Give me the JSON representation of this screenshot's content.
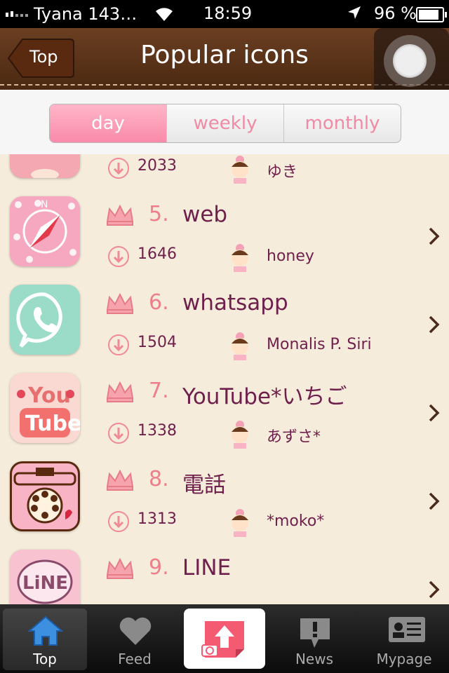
{
  "status": {
    "carrier": "Tyana 143…",
    "time": "18:59",
    "battery": "96 %"
  },
  "nav": {
    "back_label": "Top",
    "title": "Popular icons"
  },
  "segments": [
    {
      "label": "day",
      "active": true
    },
    {
      "label": "weekly",
      "active": false
    },
    {
      "label": "monthly",
      "active": false
    }
  ],
  "items": [
    {
      "rank": "",
      "name": "",
      "downloads": "2033",
      "user": "ゆき",
      "icon": "clock-icon"
    },
    {
      "rank": "5.",
      "name": "web",
      "downloads": "1646",
      "user": "honey",
      "icon": "safari-compass-icon"
    },
    {
      "rank": "6.",
      "name": "whatsapp",
      "downloads": "1504",
      "user": "Monalis P. Siri",
      "icon": "whatsapp-phone-icon"
    },
    {
      "rank": "7.",
      "name": "YouTube*いちご",
      "downloads": "1338",
      "user": "あずさ*",
      "icon": "youtube-strawberry-icon"
    },
    {
      "rank": "8.",
      "name": "電話",
      "downloads": "1313",
      "user": "*moko*",
      "icon": "rotary-phone-icon"
    },
    {
      "rank": "9.",
      "name": "LINE",
      "downloads": "",
      "user": "",
      "icon": "line-icon"
    }
  ],
  "tabs": [
    {
      "label": "Top",
      "icon": "home-icon",
      "active": true
    },
    {
      "label": "Feed",
      "icon": "heart-icon",
      "active": false
    },
    {
      "label": "",
      "icon": "upload-photo-icon",
      "active": false
    },
    {
      "label": "News",
      "icon": "news-bubble-icon",
      "active": false
    },
    {
      "label": "Mypage",
      "icon": "profile-card-icon",
      "active": false
    }
  ],
  "colors": {
    "pink": "#f98aa9",
    "brown": "#5a3218",
    "text": "#6f1f4b",
    "rank": "#ee7f8a"
  }
}
